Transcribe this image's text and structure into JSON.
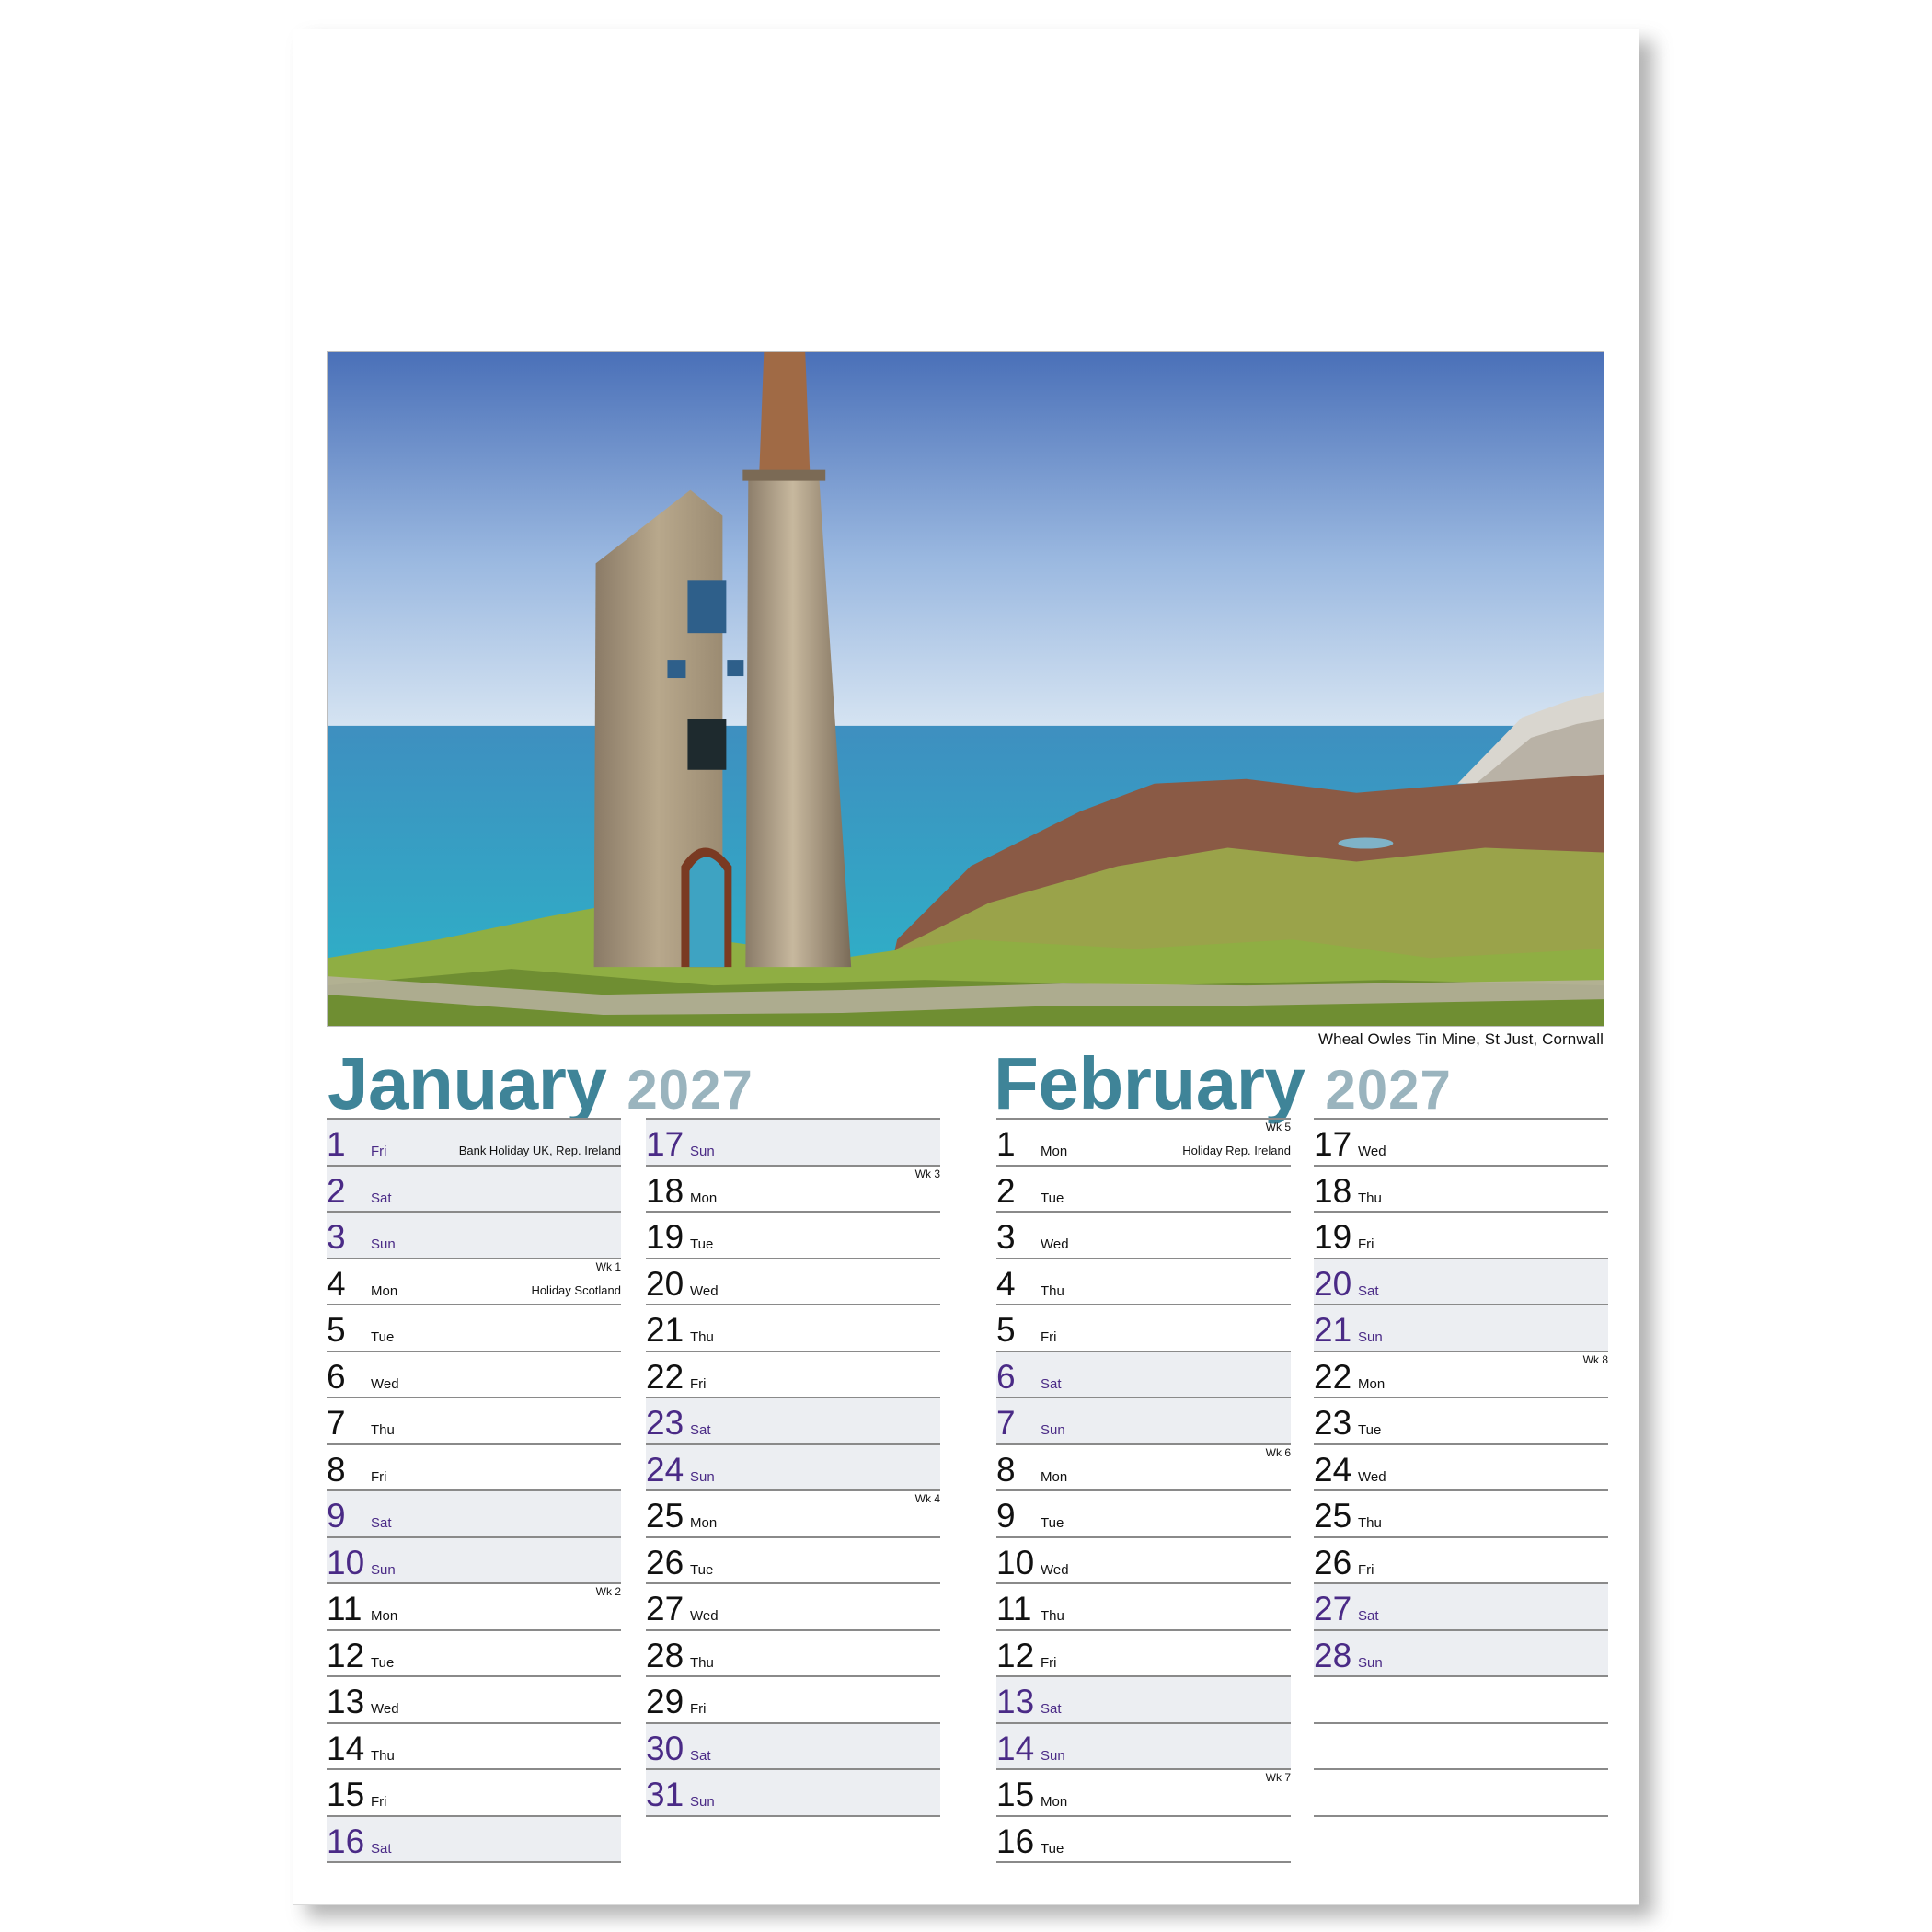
{
  "photo_caption": "Wheal Owles Tin Mine, St Just, Cornwall",
  "months": [
    {
      "name": "January",
      "year": "2027",
      "columns": [
        [
          {
            "num": "1",
            "day": "Fri",
            "wk": "",
            "hol": "Bank Holiday UK, Rep. Ireland",
            "we": true
          },
          {
            "num": "2",
            "day": "Sat",
            "wk": "",
            "hol": "",
            "we": true
          },
          {
            "num": "3",
            "day": "Sun",
            "wk": "",
            "hol": "",
            "we": true
          },
          {
            "num": "4",
            "day": "Mon",
            "wk": "Wk 1",
            "hol": "Holiday Scotland",
            "we": false
          },
          {
            "num": "5",
            "day": "Tue",
            "wk": "",
            "hol": "",
            "we": false
          },
          {
            "num": "6",
            "day": "Wed",
            "wk": "",
            "hol": "",
            "we": false
          },
          {
            "num": "7",
            "day": "Thu",
            "wk": "",
            "hol": "",
            "we": false
          },
          {
            "num": "8",
            "day": "Fri",
            "wk": "",
            "hol": "",
            "we": false
          },
          {
            "num": "9",
            "day": "Sat",
            "wk": "",
            "hol": "",
            "we": true
          },
          {
            "num": "10",
            "day": "Sun",
            "wk": "",
            "hol": "",
            "we": true
          },
          {
            "num": "11",
            "day": "Mon",
            "wk": "Wk 2",
            "hol": "",
            "we": false
          },
          {
            "num": "12",
            "day": "Tue",
            "wk": "",
            "hol": "",
            "we": false
          },
          {
            "num": "13",
            "day": "Wed",
            "wk": "",
            "hol": "",
            "we": false
          },
          {
            "num": "14",
            "day": "Thu",
            "wk": "",
            "hol": "",
            "we": false
          },
          {
            "num": "15",
            "day": "Fri",
            "wk": "",
            "hol": "",
            "we": false
          },
          {
            "num": "16",
            "day": "Sat",
            "wk": "",
            "hol": "",
            "we": true
          }
        ],
        [
          {
            "num": "17",
            "day": "Sun",
            "wk": "",
            "hol": "",
            "we": true
          },
          {
            "num": "18",
            "day": "Mon",
            "wk": "Wk 3",
            "hol": "",
            "we": false
          },
          {
            "num": "19",
            "day": "Tue",
            "wk": "",
            "hol": "",
            "we": false
          },
          {
            "num": "20",
            "day": "Wed",
            "wk": "",
            "hol": "",
            "we": false
          },
          {
            "num": "21",
            "day": "Thu",
            "wk": "",
            "hol": "",
            "we": false
          },
          {
            "num": "22",
            "day": "Fri",
            "wk": "",
            "hol": "",
            "we": false
          },
          {
            "num": "23",
            "day": "Sat",
            "wk": "",
            "hol": "",
            "we": true
          },
          {
            "num": "24",
            "day": "Sun",
            "wk": "",
            "hol": "",
            "we": true
          },
          {
            "num": "25",
            "day": "Mon",
            "wk": "Wk 4",
            "hol": "",
            "we": false
          },
          {
            "num": "26",
            "day": "Tue",
            "wk": "",
            "hol": "",
            "we": false
          },
          {
            "num": "27",
            "day": "Wed",
            "wk": "",
            "hol": "",
            "we": false
          },
          {
            "num": "28",
            "day": "Thu",
            "wk": "",
            "hol": "",
            "we": false
          },
          {
            "num": "29",
            "day": "Fri",
            "wk": "",
            "hol": "",
            "we": false
          },
          {
            "num": "30",
            "day": "Sat",
            "wk": "",
            "hol": "",
            "we": true
          },
          {
            "num": "31",
            "day": "Sun",
            "wk": "",
            "hol": "",
            "we": true
          }
        ]
      ]
    },
    {
      "name": "February",
      "year": "2027",
      "columns": [
        [
          {
            "num": "1",
            "day": "Mon",
            "wk": "Wk 5",
            "hol": "Holiday Rep. Ireland",
            "we": false
          },
          {
            "num": "2",
            "day": "Tue",
            "wk": "",
            "hol": "",
            "we": false
          },
          {
            "num": "3",
            "day": "Wed",
            "wk": "",
            "hol": "",
            "we": false
          },
          {
            "num": "4",
            "day": "Thu",
            "wk": "",
            "hol": "",
            "we": false
          },
          {
            "num": "5",
            "day": "Fri",
            "wk": "",
            "hol": "",
            "we": false
          },
          {
            "num": "6",
            "day": "Sat",
            "wk": "",
            "hol": "",
            "we": true
          },
          {
            "num": "7",
            "day": "Sun",
            "wk": "",
            "hol": "",
            "we": true
          },
          {
            "num": "8",
            "day": "Mon",
            "wk": "Wk 6",
            "hol": "",
            "we": false
          },
          {
            "num": "9",
            "day": "Tue",
            "wk": "",
            "hol": "",
            "we": false
          },
          {
            "num": "10",
            "day": "Wed",
            "wk": "",
            "hol": "",
            "we": false
          },
          {
            "num": "11",
            "day": "Thu",
            "wk": "",
            "hol": "",
            "we": false
          },
          {
            "num": "12",
            "day": "Fri",
            "wk": "",
            "hol": "",
            "we": false
          },
          {
            "num": "13",
            "day": "Sat",
            "wk": "",
            "hol": "",
            "we": true
          },
          {
            "num": "14",
            "day": "Sun",
            "wk": "",
            "hol": "",
            "we": true
          },
          {
            "num": "15",
            "day": "Mon",
            "wk": "Wk 7",
            "hol": "",
            "we": false
          },
          {
            "num": "16",
            "day": "Tue",
            "wk": "",
            "hol": "",
            "we": false
          }
        ],
        [
          {
            "num": "17",
            "day": "Wed",
            "wk": "",
            "hol": "",
            "we": false
          },
          {
            "num": "18",
            "day": "Thu",
            "wk": "",
            "hol": "",
            "we": false
          },
          {
            "num": "19",
            "day": "Fri",
            "wk": "",
            "hol": "",
            "we": false
          },
          {
            "num": "20",
            "day": "Sat",
            "wk": "",
            "hol": "",
            "we": true
          },
          {
            "num": "21",
            "day": "Sun",
            "wk": "",
            "hol": "",
            "we": true
          },
          {
            "num": "22",
            "day": "Mon",
            "wk": "Wk 8",
            "hol": "",
            "we": false
          },
          {
            "num": "23",
            "day": "Tue",
            "wk": "",
            "hol": "",
            "we": false
          },
          {
            "num": "24",
            "day": "Wed",
            "wk": "",
            "hol": "",
            "we": false
          },
          {
            "num": "25",
            "day": "Thu",
            "wk": "",
            "hol": "",
            "we": false
          },
          {
            "num": "26",
            "day": "Fri",
            "wk": "",
            "hol": "",
            "we": false
          },
          {
            "num": "27",
            "day": "Sat",
            "wk": "",
            "hol": "",
            "we": true
          },
          {
            "num": "28",
            "day": "Sun",
            "wk": "",
            "hol": "",
            "we": true
          },
          {
            "num": "",
            "day": "",
            "wk": "",
            "hol": "",
            "we": false
          },
          {
            "num": "",
            "day": "",
            "wk": "",
            "hol": "",
            "we": false
          },
          {
            "num": "",
            "day": "",
            "wk": "",
            "hol": "",
            "we": false
          }
        ]
      ]
    }
  ]
}
